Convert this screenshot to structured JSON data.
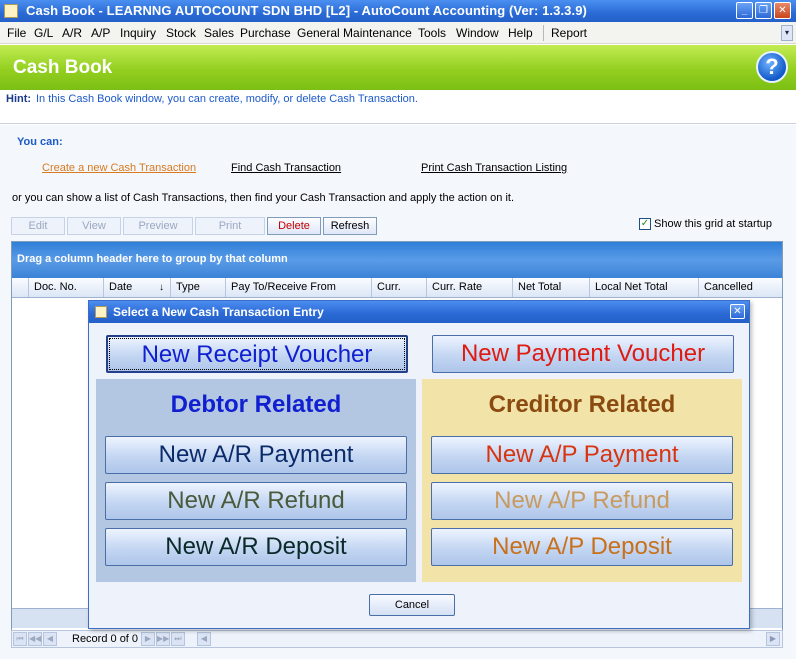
{
  "window": {
    "title": "Cash Book - LEARNNG AUTOCOUNT SDN BHD [L2] - AutoCount Accounting (Ver: 1.3.3.9)",
    "minimize": "_",
    "restore": "❐",
    "close": "✕"
  },
  "menu": {
    "items": [
      "File",
      "G/L",
      "A/R",
      "A/P",
      "Inquiry",
      "Stock",
      "Sales",
      "Purchase",
      "General Maintenance",
      "Tools",
      "Window",
      "Help",
      "Report"
    ],
    "overflow": "▾"
  },
  "header": {
    "title": "Cash Book",
    "help_glyph": "?"
  },
  "hint": {
    "label": "Hint:",
    "text": "In this Cash Book window, you can create, modify, or delete Cash Transaction."
  },
  "actions": {
    "you_can": "You can:",
    "create_link": "Create a new Cash Transaction",
    "find_link": "Find Cash Transaction",
    "print_link": "Print Cash Transaction Listing",
    "or_text": "or you can show a list of Cash Transactions, then find your Cash Transaction and apply the action on it."
  },
  "toolbar": {
    "edit": "Edit",
    "view": "View",
    "preview": "Preview",
    "print": "Print",
    "delete": "Delete",
    "refresh": "Refresh",
    "show_grid": "Show this grid at startup",
    "check_mark": "✓"
  },
  "grid": {
    "group_hint": "Drag a column header here to group by that column",
    "columns": [
      "Doc. No.",
      "Date",
      "Type",
      "Pay To/Receive From",
      "Curr.",
      "Curr. Rate",
      "Net Total",
      "Local Net Total",
      "Cancelled"
    ],
    "sort_glyph": "↓"
  },
  "navigator": {
    "first": "⏮",
    "prev_page": "◀◀",
    "prev": "◀",
    "record_text": "Record 0 of 0",
    "next": "▶",
    "next_page": "▶▶",
    "last": "⏭",
    "scroll_left": "◀",
    "scroll_right": "▶"
  },
  "dialog": {
    "title": "Select a New Cash Transaction Entry",
    "close": "✕",
    "receipt": "New Receipt Voucher",
    "payment": "New Payment Voucher",
    "debtor_title": "Debtor Related",
    "creditor_title": "Creditor Related",
    "ar_payment": "New A/R Payment",
    "ar_refund": "New A/R Refund",
    "ar_deposit": "New A/R Deposit",
    "ap_payment": "New A/P Payment",
    "ap_refund": "New A/P Refund",
    "ap_deposit": "New A/P Deposit",
    "cancel": "Cancel"
  },
  "colors": {
    "receipt_text": "#1020d0",
    "payment_text": "#e01a10",
    "debtor_title": "#1020d0",
    "creditor_title": "#8a4a10",
    "ar_payment": "#0a2a6a",
    "ar_refund": "#4a5a3a",
    "ar_deposit": "#0a2a2a",
    "ap_payment": "#d83410",
    "ap_refund": "#c89a60",
    "ap_deposit": "#c8701a"
  }
}
